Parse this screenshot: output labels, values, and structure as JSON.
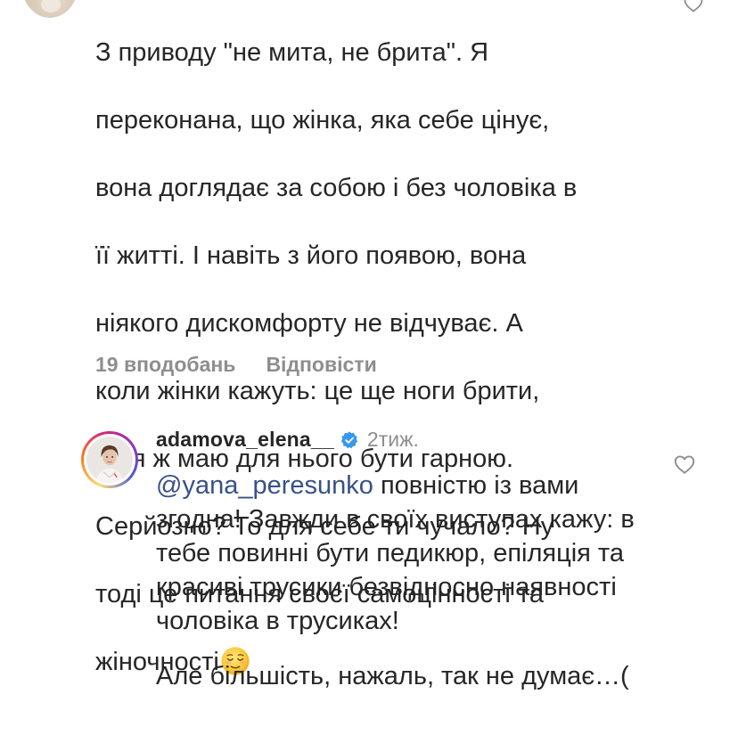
{
  "comment1": {
    "lines": [
      "З приводу \"не мита, не брита\". Я",
      "переконана, що жінка, яка себе цінує,",
      "вона доглядає за собою і без чоловіка в",
      "її житті. І навіть з його появою, вона",
      "ніякого дискомфорту не відчуває. А",
      "коли жінки кажуть: це ще ноги брити,",
      "бо я ж маю для нього бути гарною.",
      "Серйозно? То для себе ти чучало? Ну",
      "тоді це питання своєї самоцінності та",
      "жіночності"
    ],
    "emoji": "relieved-face",
    "likes": "19 вподобань",
    "reply_label": "Відповісти"
  },
  "reply": {
    "username": "adamova_elena__",
    "verified": true,
    "time": "2тиж.",
    "mention": "@yana_peresunko",
    "text_after_mention": " повністю із вами згодна! Завжди в своїх виступах кажу: в тебе повинні бути педикюр, епіляція та красиві трусики безвідносно наявності чоловіка в трусиках!",
    "para2": "Але більшість, нажаль, так не думає…("
  },
  "icons": {
    "like": "heart-outline-icon",
    "verified": "verified-badge-icon"
  },
  "colors": {
    "text": "#262626",
    "secondary": "#8e8e8e",
    "mention": "#385185",
    "verified": "#3897f0"
  }
}
